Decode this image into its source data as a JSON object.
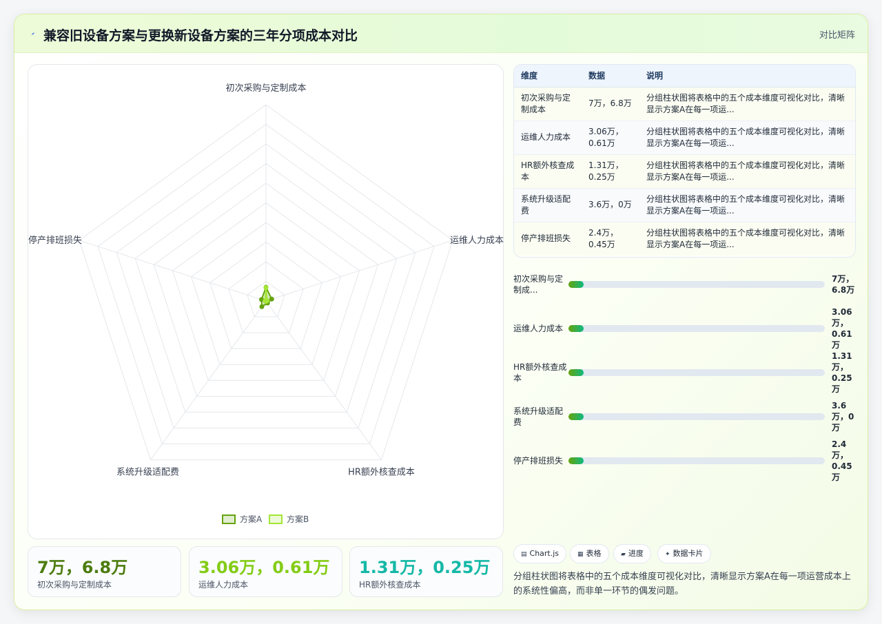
{
  "header": {
    "title": "兼容旧设备方案与更换新设备方案的三年分项成本对比",
    "tag": "对比矩阵"
  },
  "chart_data": {
    "type": "radar",
    "categories": [
      "初次采购与定制成本",
      "运维人力成本",
      "HR额外核查成本",
      "系统升级适配费",
      "停产排班损失"
    ],
    "series": [
      {
        "name": "方案A",
        "values": [
          7,
          3.06,
          1.31,
          3.6,
          2.4
        ],
        "color": "#65a30d"
      },
      {
        "name": "方案B",
        "values": [
          6.8,
          0.61,
          0.25,
          0,
          0.45
        ],
        "color": "#a3e635"
      }
    ],
    "rmax": 100,
    "grid_levels": 10,
    "legend": "bottom"
  },
  "kpis": [
    {
      "value": "7万，6.8万",
      "label": "初次采购与定制成本",
      "color": "#4d7c0f"
    },
    {
      "value": "3.06万，0.61万",
      "label": "运维人力成本",
      "color": "#84cc16"
    },
    {
      "value": "1.31万，0.25万",
      "label": "HR额外核查成本",
      "color": "#14b8a6"
    }
  ],
  "table": {
    "headers": [
      "维度",
      "数据",
      "说明"
    ],
    "rows": [
      {
        "dim": "初次采购与定制成本",
        "data": "7万，6.8万",
        "desc": "分组柱状图将表格中的五个成本维度可视化对比，清晰显示方案A在每一项运..."
      },
      {
        "dim": "运维人力成本",
        "data": "3.06万，0.61万",
        "desc": "分组柱状图将表格中的五个成本维度可视化对比，清晰显示方案A在每一项运..."
      },
      {
        "dim": "HR额外核查成本",
        "data": "1.31万，0.25万",
        "desc": "分组柱状图将表格中的五个成本维度可视化对比，清晰显示方案A在每一项运..."
      },
      {
        "dim": "系统升级适配费",
        "data": "3.6万，0万",
        "desc": "分组柱状图将表格中的五个成本维度可视化对比，清晰显示方案A在每一项运..."
      },
      {
        "dim": "停产排班损失",
        "data": "2.4万，0.45万",
        "desc": "分组柱状图将表格中的五个成本维度可视化对比，清晰显示方案A在每一项运..."
      }
    ]
  },
  "progress": [
    {
      "label": "初次采购与定制成...",
      "value": "7万，6.8万",
      "fraction": 0.06
    },
    {
      "label": "运维人力成本",
      "value": "3.06万，0.61万",
      "fraction": 0.06
    },
    {
      "label": "HR额外核查成本",
      "value": "1.31万，0.25万",
      "fraction": 0.06
    },
    {
      "label": "系统升级适配费",
      "value": "3.6万，0万",
      "fraction": 0.06
    },
    {
      "label": "停产排班损失",
      "value": "2.4万，0.45万",
      "fraction": 0.06
    }
  ],
  "chips": [
    {
      "icon": "chart-icon",
      "glyph": "▤",
      "label": "Chart.js"
    },
    {
      "icon": "table-icon",
      "glyph": "▦",
      "label": "表格"
    },
    {
      "icon": "progress-icon",
      "glyph": "▰",
      "label": "进度"
    },
    {
      "icon": "card-icon",
      "glyph": "✦",
      "label": "数据卡片"
    }
  ],
  "summary": "分组柱状图将表格中的五个成本维度可视化对比，清晰显示方案A在每一项运营成本上的系统性偏高，而非单一环节的偶发问题。"
}
